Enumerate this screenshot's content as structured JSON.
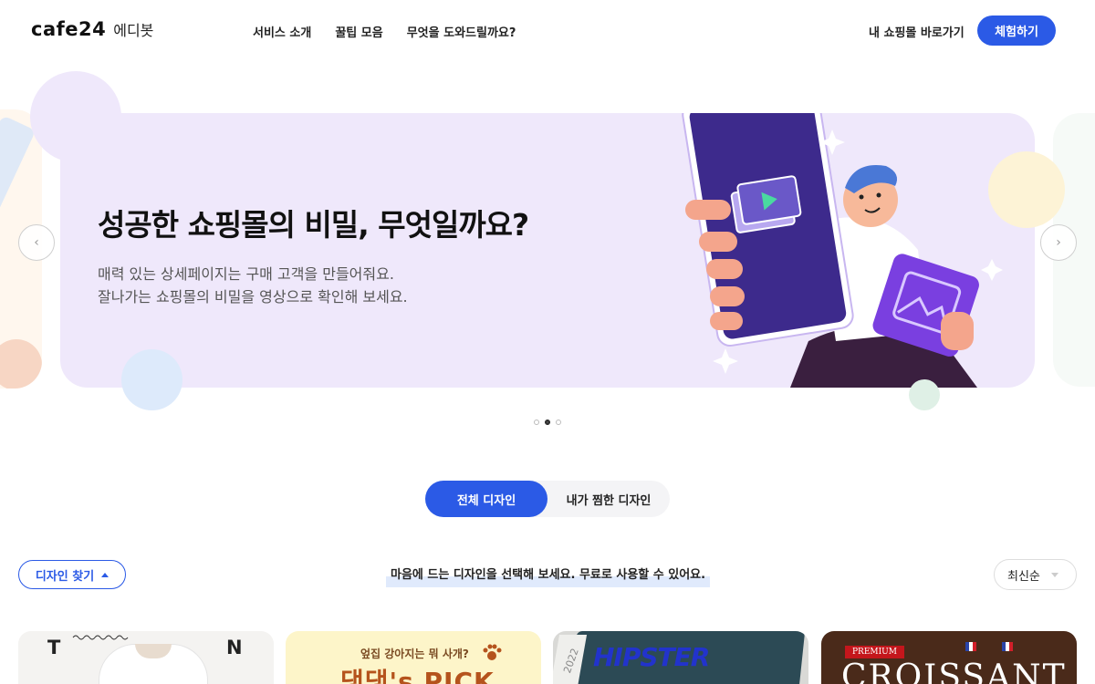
{
  "header": {
    "logo_word": "cafe24",
    "logo_sub": "에디봇",
    "nav": [
      "서비스 소개",
      "꿀팁 모음",
      "무엇을 도와드릴까요?"
    ],
    "my_mall_link": "내 쇼핑몰 바로가기",
    "trial_button": "체험하기"
  },
  "hero": {
    "title": "성공한 쇼핑몰의 비밀, 무엇일까요?",
    "desc_line1": "매력 있는 상세페이지는 구매 고객을 만들어줘요.",
    "desc_line2": "잘나가는 쇼핑몰의 비밀을 영상으로 확인해 보세요.",
    "slides_total": 3,
    "slide_active": 2,
    "prev_icon": "chevron-left-icon",
    "next_icon": "chevron-right-icon"
  },
  "tabs": {
    "all": "전체 디자인",
    "favorites": "내가 찜한 디자인",
    "selected": "all"
  },
  "filter": {
    "find_button": "디자인 찾기",
    "notice": "마음에 드는 디자인을 선택해 보세요.  무료로 사용할 수 있어요.",
    "sort_selected": "최신순"
  },
  "cards": [
    {
      "letters": [
        "T",
        "N"
      ]
    },
    {
      "subtitle": "엎집 강아지는 뭐 사개?",
      "title": "댕댕's PICK"
    },
    {
      "year": "2022",
      "title": "HIPSTER"
    },
    {
      "badge": "PREMIUM",
      "title": "CROISSANT"
    }
  ],
  "colors": {
    "accent": "#2b5ae6",
    "hero_bg": "#efe8fb",
    "phone": "#3d2a8c"
  }
}
